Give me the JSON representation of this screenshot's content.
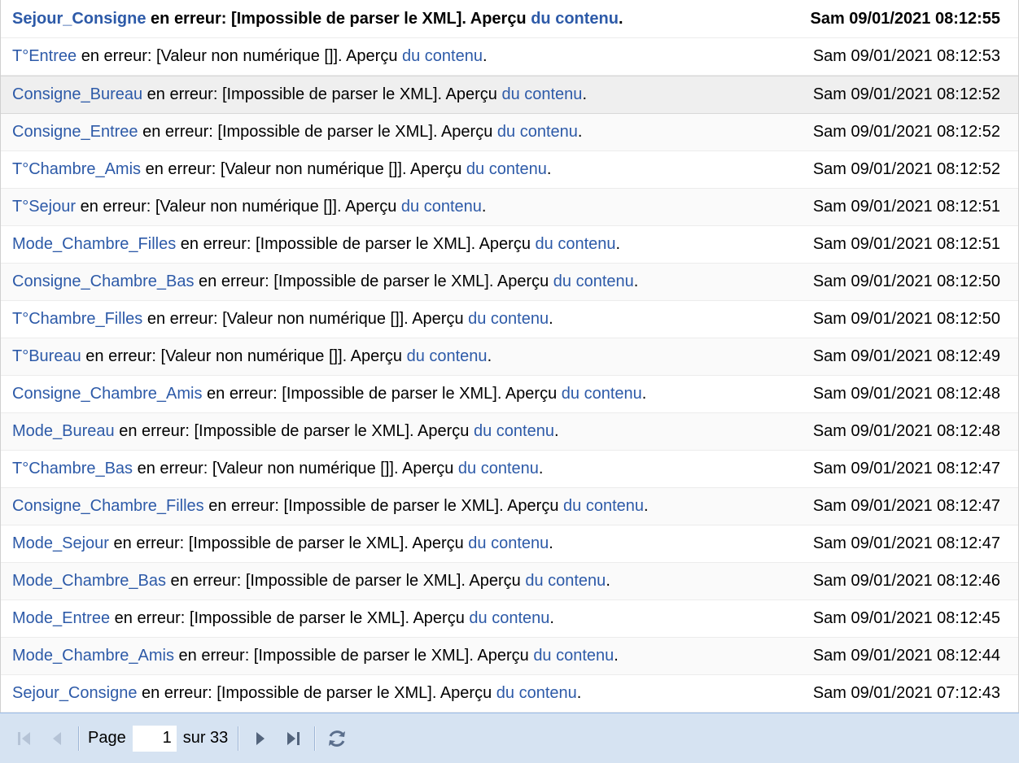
{
  "log": {
    "rows": [
      {
        "name": "Sejour_Consigne",
        "middle": " en erreur: [Impossible de parser le XML]. Aperçu ",
        "link": "du contenu",
        "end": ".",
        "date": "Sam 09/01/2021 08:12:55"
      },
      {
        "name": "T°Entree",
        "middle": " en erreur: [Valeur non numérique []]. Aperçu ",
        "link": "du contenu",
        "end": ".",
        "date": "Sam 09/01/2021 08:12:53"
      },
      {
        "name": "Consigne_Bureau",
        "middle": " en erreur: [Impossible de parser le XML]. Aperçu ",
        "link": "du contenu",
        "end": ".",
        "date": "Sam 09/01/2021 08:12:52"
      },
      {
        "name": "Consigne_Entree",
        "middle": " en erreur: [Impossible de parser le XML]. Aperçu ",
        "link": "du contenu",
        "end": ".",
        "date": "Sam 09/01/2021 08:12:52"
      },
      {
        "name": "T°Chambre_Amis",
        "middle": " en erreur: [Valeur non numérique []]. Aperçu ",
        "link": "du contenu",
        "end": ".",
        "date": "Sam 09/01/2021 08:12:52"
      },
      {
        "name": "T°Sejour",
        "middle": " en erreur: [Valeur non numérique []]. Aperçu ",
        "link": "du contenu",
        "end": ".",
        "date": "Sam 09/01/2021 08:12:51"
      },
      {
        "name": "Mode_Chambre_Filles",
        "middle": " en erreur: [Impossible de parser le XML]. Aperçu ",
        "link": "du contenu",
        "end": ".",
        "date": "Sam 09/01/2021 08:12:51"
      },
      {
        "name": "Consigne_Chambre_Bas",
        "middle": " en erreur: [Impossible de parser le XML]. Aperçu ",
        "link": "du contenu",
        "end": ".",
        "date": "Sam 09/01/2021 08:12:50"
      },
      {
        "name": "T°Chambre_Filles",
        "middle": " en erreur: [Valeur non numérique []]. Aperçu ",
        "link": "du contenu",
        "end": ".",
        "date": "Sam 09/01/2021 08:12:50"
      },
      {
        "name": "T°Bureau",
        "middle": " en erreur: [Valeur non numérique []]. Aperçu ",
        "link": "du contenu",
        "end": ".",
        "date": "Sam 09/01/2021 08:12:49"
      },
      {
        "name": "Consigne_Chambre_Amis",
        "middle": " en erreur: [Impossible de parser le XML]. Aperçu ",
        "link": "du contenu",
        "end": ".",
        "date": "Sam 09/01/2021 08:12:48"
      },
      {
        "name": "Mode_Bureau",
        "middle": " en erreur: [Impossible de parser le XML]. Aperçu ",
        "link": "du contenu",
        "end": ".",
        "date": "Sam 09/01/2021 08:12:48"
      },
      {
        "name": "T°Chambre_Bas",
        "middle": " en erreur: [Valeur non numérique []]. Aperçu ",
        "link": "du contenu",
        "end": ".",
        "date": "Sam 09/01/2021 08:12:47"
      },
      {
        "name": "Consigne_Chambre_Filles",
        "middle": " en erreur: [Impossible de parser le XML]. Aperçu ",
        "link": "du contenu",
        "end": ".",
        "date": "Sam 09/01/2021 08:12:47"
      },
      {
        "name": "Mode_Sejour",
        "middle": " en erreur: [Impossible de parser le XML]. Aperçu ",
        "link": "du contenu",
        "end": ".",
        "date": "Sam 09/01/2021 08:12:47"
      },
      {
        "name": "Mode_Chambre_Bas",
        "middle": " en erreur: [Impossible de parser le XML]. Aperçu ",
        "link": "du contenu",
        "end": ".",
        "date": "Sam 09/01/2021 08:12:46"
      },
      {
        "name": "Mode_Entree",
        "middle": " en erreur: [Impossible de parser le XML]. Aperçu ",
        "link": "du contenu",
        "end": ".",
        "date": "Sam 09/01/2021 08:12:45"
      },
      {
        "name": "Mode_Chambre_Amis",
        "middle": " en erreur: [Impossible de parser le XML]. Aperçu ",
        "link": "du contenu",
        "end": ".",
        "date": "Sam 09/01/2021 08:12:44"
      },
      {
        "name": "Sejour_Consigne",
        "middle": " en erreur: [Impossible de parser le XML]. Aperçu ",
        "link": "du contenu",
        "end": ".",
        "date": "Sam 09/01/2021 07:12:43"
      }
    ]
  },
  "pager": {
    "page_label": "Page",
    "page_value": "1",
    "of_label": "sur 33",
    "icons": [
      "first-page-icon",
      "prev-page-icon",
      "next-page-icon",
      "last-page-icon",
      "refresh-icon"
    ]
  },
  "colors": {
    "link": "#2d5aa8",
    "toolbar_bg": "#d6e3f2",
    "toolbar_border": "#99bbe8"
  }
}
